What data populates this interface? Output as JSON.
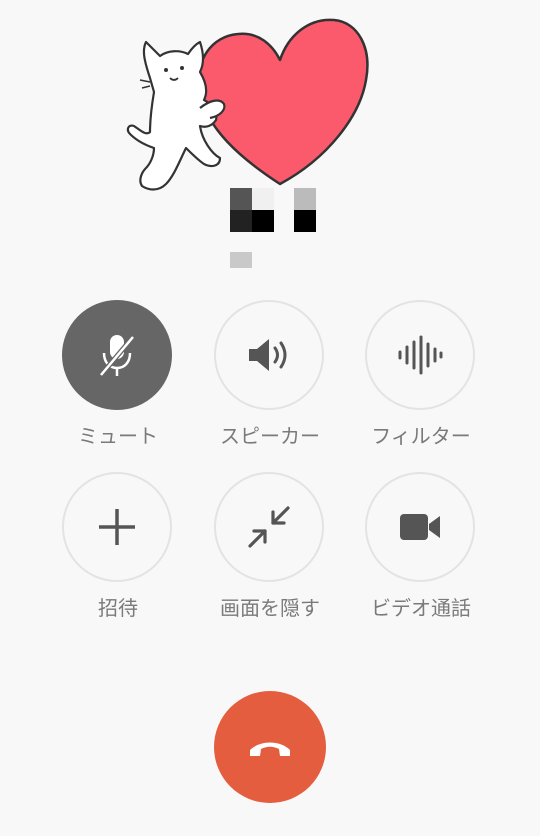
{
  "call": {
    "controls": [
      {
        "id": "mute",
        "label": "ミュート",
        "icon": "mic-off-icon",
        "active": true
      },
      {
        "id": "speaker",
        "label": "スピーカー",
        "icon": "speaker-icon",
        "active": false
      },
      {
        "id": "filter",
        "label": "フィルター",
        "icon": "waveform-icon",
        "active": false
      },
      {
        "id": "invite",
        "label": "招待",
        "icon": "plus-icon",
        "active": false
      },
      {
        "id": "hide-screen",
        "label": "画面を隠す",
        "icon": "minimize-icon",
        "active": false
      },
      {
        "id": "video-call",
        "label": "ビデオ通話",
        "icon": "video-camera-icon",
        "active": false
      }
    ],
    "end_call_icon": "phone-hangup-icon"
  },
  "colors": {
    "background": "#f8f8f8",
    "active_button": "#666666",
    "end_call": "#e35d3e",
    "heart": "#fb5a6c",
    "icon": "#555555",
    "label": "#7a7a7a"
  }
}
